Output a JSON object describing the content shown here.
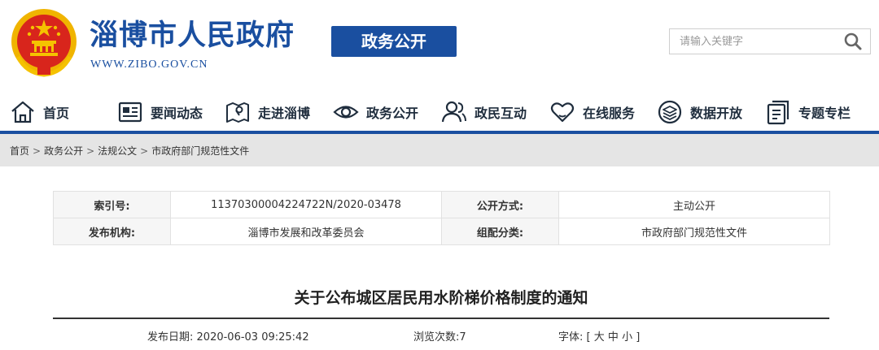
{
  "header": {
    "site_title": "淄博市人民政府",
    "site_url": "WWW.ZIBO.GOV.CN",
    "section_badge": "政务公开",
    "search_placeholder": "请输入关键字"
  },
  "nav": {
    "items": [
      {
        "label": "首页",
        "icon": "home-icon"
      },
      {
        "label": "要闻动态",
        "icon": "news-icon"
      },
      {
        "label": "走进淄博",
        "icon": "map-pin-icon"
      },
      {
        "label": "政务公开",
        "icon": "eye-icon"
      },
      {
        "label": "政民互动",
        "icon": "people-icon"
      },
      {
        "label": "在线服务",
        "icon": "heart-icon"
      },
      {
        "label": "数据开放",
        "icon": "data-layers-icon"
      },
      {
        "label": "专题专栏",
        "icon": "document-icon"
      }
    ]
  },
  "breadcrumb": {
    "items": [
      "首页",
      "政务公开",
      "法规公文",
      "市政府部门规范性文件"
    ],
    "separator": ">"
  },
  "meta_table": {
    "rows": [
      [
        {
          "key": "索引号:",
          "value": "11370300004224722N/2020-03478"
        },
        {
          "key": "公开方式:",
          "value": "主动公开"
        }
      ],
      [
        {
          "key": "发布机构:",
          "value": "淄博市发展和改革委员会"
        },
        {
          "key": "组配分类:",
          "value": "市政府部门规范性文件"
        }
      ]
    ]
  },
  "article": {
    "title": "关于公布城区居民用水阶梯价格制度的通知",
    "publish_label": "发布日期:",
    "publish_date": "2020-06-03 09:25:42",
    "views_label": "浏览次数:",
    "views": "7",
    "font_label": "字体:",
    "font_open": "[",
    "font_large": "大",
    "font_medium": "中",
    "font_small": "小",
    "font_close": "]"
  },
  "colors": {
    "brand_blue": "#1a4fa0",
    "emblem_red": "#d8251c",
    "emblem_gold": "#f5c200",
    "breadcrumb_bg": "#e5e5e5"
  }
}
